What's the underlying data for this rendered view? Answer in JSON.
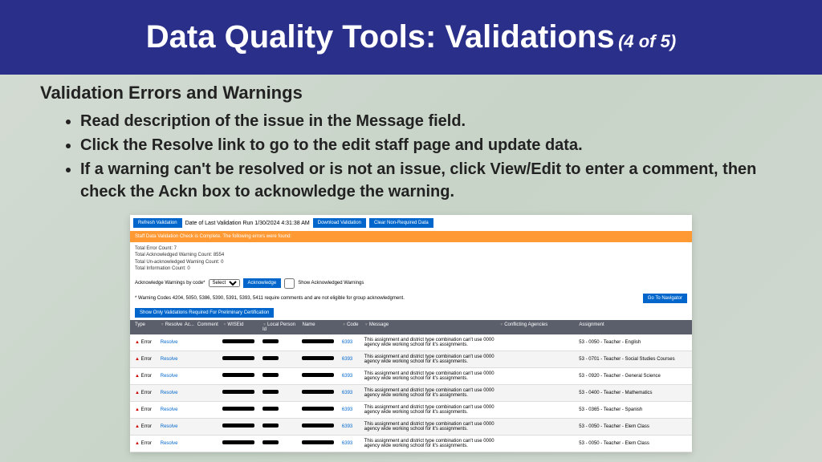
{
  "header": {
    "title": "Data Quality Tools: Validations",
    "subtitle": "(4 of 5)"
  },
  "sectionTitle": "Validation Errors and Warnings",
  "bullets": [
    "Read description of the issue in the Message field.",
    "Click the Resolve link to go to the edit staff page and update data.",
    "If a warning can't be resolved or is not an issue, click View/Edit  to enter a comment, then check the Ackn box to acknowledge the warning."
  ],
  "ss": {
    "refresh": "Refresh Validation",
    "lastRun": "Date of Last Validation Run 1/30/2024 4:31:38 AM",
    "download": "Download Validation",
    "clear": "Clear Non-Required Data",
    "orange": "Staff Data Validation Check is Complete. The following errors were found:",
    "counts": [
      "Total Error Count: 7",
      "Total Acknowledged Warning Count: 8554",
      "Total Un-acknowledged Warning Count: 0",
      "Total Information Count: 0"
    ],
    "ackLabel": "Acknowledge Warnings by code*",
    "selectLabel": "Select",
    "ackBtn": "Acknowledge",
    "showAck": "Show Acknowledged Warnings",
    "note": "* Warning Codes 4204, 5050, 5386, 5390, 5391, 5393, 5411 require comments and are not eligible for group acknowledgment.",
    "goNav": "Go To Navigator",
    "showOnly": "Show Only Validations Required For Preliminary Certification",
    "cols": {
      "type": "Type",
      "resolve": "Resolve",
      "ac": "Ac...",
      "comment": "Comment",
      "wiseid": "WISEid",
      "localId": "Local Person Id",
      "name": "Name",
      "code": "Code",
      "message": "Message",
      "conflicting": "Conflicting Agencies",
      "assignment": "Assignment"
    },
    "rows": [
      {
        "code": "6393",
        "msg": "This assignment and district type combination can't use 0000 agency wide working school for it's assignments.",
        "assign": "53 - 0050 - Teacher - English"
      },
      {
        "code": "6393",
        "msg": "This assignment and district type combination can't use 0000 agency wide working school for it's assignments.",
        "assign": "53 - 0701 - Teacher - Social Studies Courses"
      },
      {
        "code": "6393",
        "msg": "This assignment and district type combination can't use 0000 agency wide working school for it's assignments.",
        "assign": "53 - 0920 - Teacher - General Science"
      },
      {
        "code": "6393",
        "msg": "This assignment and district type combination can't use 0000 agency wide working school for it's assignments.",
        "assign": "53 - 0400 - Teacher - Mathematics"
      },
      {
        "code": "6393",
        "msg": "This assignment and district type combination can't use 0000 agency wide working school for it's assignments.",
        "assign": "53 - 0365 - Teacher - Spanish"
      },
      {
        "code": "6393",
        "msg": "This assignment and district type combination can't use 0000 agency wide working school for it's assignments.",
        "assign": "53 - 0050 - Teacher - Elem Class"
      },
      {
        "code": "6393",
        "msg": "This assignment and district type combination can't use 0000 agency wide working school for it's assignments.",
        "assign": "53 - 0050 - Teacher - Elem Class"
      }
    ],
    "errLabel": "Error",
    "resolveLabel": "Resolve"
  }
}
